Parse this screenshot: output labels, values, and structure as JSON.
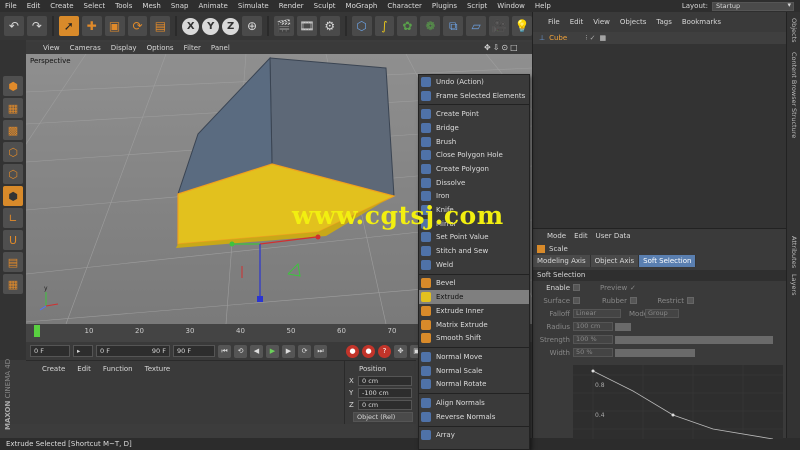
{
  "menubar": {
    "items": [
      "File",
      "Edit",
      "Create",
      "Select",
      "Tools",
      "Mesh",
      "Snap",
      "Animate",
      "Simulate",
      "Render",
      "Sculpt",
      "MoGraph",
      "Character",
      "Plugins",
      "Script",
      "Window",
      "Help"
    ],
    "layout_label": "Layout:",
    "layout_value": "Startup"
  },
  "viewport": {
    "menu": [
      "View",
      "Cameras",
      "Display",
      "Options",
      "Filter",
      "Panel"
    ],
    "label": "Perspective",
    "icons": "✥⇩⊙□"
  },
  "timeline": {
    "ticks": [
      "0",
      "10",
      "20",
      "30",
      "40",
      "50",
      "60",
      "70"
    ],
    "current_frame": "0 F",
    "min_frame": "0 F",
    "max_frame": "90 F",
    "end_frame": "90 F"
  },
  "material_manager": {
    "menu": [
      "Create",
      "Edit",
      "Function",
      "Texture"
    ]
  },
  "branding": {
    "maxon": "MAXON",
    "product": "CINEMA 4D"
  },
  "coordinates": {
    "header": "Position",
    "x": "0 cm",
    "y": "-100 cm",
    "z": "0 cm",
    "mode": "Object (Rel)"
  },
  "status": "Extrude Selected [Shortcut M~T, D]",
  "object_manager": {
    "menu": [
      "File",
      "Edit",
      "View",
      "Objects",
      "Tags",
      "Bookmarks"
    ],
    "object_name": "Cube"
  },
  "right_tabs": [
    "Objects",
    "Content Browser",
    "Structure",
    "Attributes",
    "Layers"
  ],
  "attributes": {
    "menu": [
      "Mode",
      "Edit",
      "User Data"
    ],
    "title": "Scale",
    "tabs": [
      "Modeling Axis",
      "Object Axis",
      "Soft Selection"
    ],
    "section": "Soft Selection",
    "enable_label": "Enable",
    "preview_label": "Preview",
    "surface_label": "Surface",
    "rubber_label": "Rubber",
    "restrict_label": "Restrict",
    "falloff_label": "Falloff",
    "falloff_value": "Linear",
    "mode_label": "Mode",
    "mode_value": "Group",
    "radius_label": "Radius",
    "radius_value": "100 cm",
    "strength_label": "Strength",
    "strength_value": "100 %",
    "width_label": "Width",
    "width_value": "50 %",
    "curve_labels": [
      "0.8",
      "0.4"
    ]
  },
  "context_menu": {
    "group1": [
      "Undo (Action)",
      "Frame Selected Elements"
    ],
    "group2": [
      "Create Point",
      "Bridge",
      "Brush",
      "Close Polygon Hole",
      "Create Polygon",
      "Dissolve",
      "Iron",
      "Knife",
      "Mirror",
      "Set Point Value",
      "Stitch and Sew",
      "Weld"
    ],
    "group3": [
      "Bevel",
      "Extrude",
      "Extrude Inner",
      "Matrix Extrude",
      "Smooth Shift"
    ],
    "group4": [
      "Normal Move",
      "Normal Scale",
      "Normal Rotate"
    ],
    "group5": [
      "Align Normals",
      "Reverse Normals"
    ],
    "group6": [
      "Array"
    ],
    "highlighted": "Extrude"
  },
  "watermark": "www.cgtsj.com",
  "colors": {
    "accent": "#d88a2a",
    "selection": "#e6c81c",
    "tab_active": "#5a7fb0"
  }
}
